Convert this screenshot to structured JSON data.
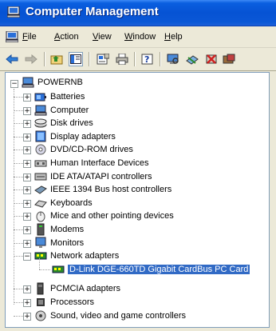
{
  "window": {
    "title": "Computer Management"
  },
  "menu": [
    {
      "key": "F",
      "rest": "ile"
    },
    {
      "key": "A",
      "rest": "ction"
    },
    {
      "key": "V",
      "rest": "iew"
    },
    {
      "key": "W",
      "rest": "indow"
    },
    {
      "key": "H",
      "rest": "elp"
    }
  ],
  "toolbar": {
    "icons": [
      "back-arrow-icon",
      "forward-arrow-icon",
      "up-folder-icon",
      "show-hide-tree-icon",
      "properties-icon",
      "print-icon",
      "help-icon",
      "scan-hardware-icon",
      "update-driver-icon",
      "uninstall-icon",
      "disable-icon"
    ]
  },
  "tree": {
    "root": "POWERNB",
    "items": [
      {
        "label": "Batteries",
        "icon": "battery-icon"
      },
      {
        "label": "Computer",
        "icon": "computer-icon"
      },
      {
        "label": "Disk drives",
        "icon": "disk-drive-icon"
      },
      {
        "label": "Display adapters",
        "icon": "display-adapter-icon"
      },
      {
        "label": "DVD/CD-ROM drives",
        "icon": "dvd-drive-icon"
      },
      {
        "label": "Human Interface Devices",
        "icon": "hid-icon"
      },
      {
        "label": "IDE ATA/ATAPI controllers",
        "icon": "ide-controller-icon"
      },
      {
        "label": "IEEE 1394 Bus host controllers",
        "icon": "ieee1394-icon"
      },
      {
        "label": "Keyboards",
        "icon": "keyboard-icon"
      },
      {
        "label": "Mice and other pointing devices",
        "icon": "mouse-icon"
      },
      {
        "label": "Modems",
        "icon": "modem-icon"
      },
      {
        "label": "Monitors",
        "icon": "monitor-icon"
      },
      {
        "label": "Network adapters",
        "icon": "network-adapter-icon",
        "expanded": true
      },
      {
        "label": "D-Link DGE-660TD Gigabit CardBus PC Card",
        "icon": "network-card-icon",
        "child": true,
        "selected": true
      },
      {
        "label": "PCMCIA adapters",
        "icon": "pcmcia-icon"
      },
      {
        "label": "Processors",
        "icon": "processor-icon"
      },
      {
        "label": "Sound, video and game controllers",
        "icon": "sound-icon"
      }
    ]
  },
  "colors": {
    "selection": "#316ac5",
    "titlebar": "#0653d4"
  }
}
